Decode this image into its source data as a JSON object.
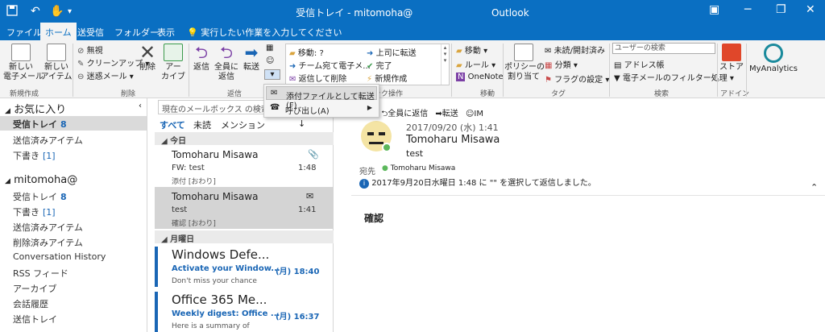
{
  "titlebar": {
    "title": "受信トレイ - mitomoha@",
    "app": "Outlook",
    "icons": {
      "save": "save-icon",
      "undo": "undo-icon",
      "touch": "touch-mode-icon",
      "customize": "customize-qat-icon",
      "ribbon_opts": "ribbon-display-options-icon",
      "minimize": "minimize-icon",
      "restore": "restore-icon",
      "close": "close-icon"
    },
    "symbols": {
      "undo": "↶",
      "touch": "✋",
      "more": "▾",
      "ribbon": "▣",
      "minimize": "─",
      "restore": "❐",
      "close": "✕"
    }
  },
  "tabs": [
    "ファイル",
    "ホーム",
    "送受信",
    "フォルダー",
    "表示"
  ],
  "tellme": "実行したい作業を入力してください",
  "ribbon": {
    "new_email": "新しい\n電子メール",
    "new_items": "新しい\nアイテム",
    "group_new": "新規作成",
    "ignore": "無視",
    "cleanup": "クリーンアップ",
    "junk": "迷惑メール",
    "delete": "削除",
    "archive": "アー\nカイブ",
    "group_delete": "削除",
    "reply": "返信",
    "reply_all": "全員に\n返信",
    "forward": "転送",
    "group_respond": "返信",
    "qs": [
      "移動: ?",
      "チーム宛て電子メ...",
      "返信して削除",
      "上司に転送",
      "完了",
      "新規作成"
    ],
    "group_qs": "クイック操作",
    "move": "移動",
    "rules": "ルール",
    "onenote": "OneNote",
    "group_move": "移動",
    "policy": "ポリシーの\n割り当て",
    "unread": "未読/開封済み",
    "categorize": "分類",
    "followup": "フラグの設定",
    "group_tags": "タグ",
    "search_people": "ユーザーの検索",
    "address_book": "アドレス帳",
    "filter_email": "電子メールのフィルター処理",
    "group_find": "検索",
    "store": "ストア",
    "group_addins": "アドイン",
    "myanalytics": "MyAnalytics"
  },
  "dropdown": {
    "items": [
      "添付ファイルとして転送(F)",
      "呼び出し(A)"
    ]
  },
  "folders": {
    "favorites": "お気に入り",
    "fav_items": [
      {
        "label": "受信トレイ",
        "count": "8"
      },
      {
        "label": "送信済みアイテム",
        "count": ""
      },
      {
        "label": "下書き",
        "count": "[1]"
      }
    ],
    "account": "mitomoha@",
    "acct_items": [
      {
        "label": "受信トレイ",
        "count": "8"
      },
      {
        "label": "下書き",
        "count": "[1]"
      },
      {
        "label": "送信済みアイテム",
        "count": ""
      },
      {
        "label": "削除済みアイテム",
        "count": ""
      },
      {
        "label": "Conversation History",
        "count": ""
      },
      {
        "label": "RSS フィード",
        "count": ""
      },
      {
        "label": "アーカイブ",
        "count": ""
      },
      {
        "label": "会話履歴",
        "count": ""
      },
      {
        "label": "送信トレイ",
        "count": ""
      }
    ]
  },
  "messagelist": {
    "search_placeholder": "現在のメールボックス の検索",
    "filters": [
      "すべて",
      "未読",
      "メンション"
    ],
    "sort": "↓",
    "groups": [
      "今日",
      "月曜日"
    ],
    "messages": [
      {
        "sender": "Tomoharu Misawa",
        "subject": "FW: test",
        "preview": "添付 [おわり]",
        "time": "1:48"
      },
      {
        "sender": "Tomoharu Misawa",
        "subject": "test",
        "preview": "確認 [おわり]",
        "time": "1:41"
      },
      {
        "sender": "Windows Defe...",
        "subject": "Activate your Window...",
        "date": "(月) 18:40",
        "preview": "Don't miss your chance"
      },
      {
        "sender": "Office 365 Me...",
        "subject": "Weekly digest: Office ...",
        "date": "(月) 16:37",
        "preview": "Here is a summary of"
      }
    ]
  },
  "reading": {
    "actions": [
      "返信",
      "全員に返信",
      "転送",
      "IM"
    ],
    "date": "2017/09/20 (水) 1:41",
    "sender": "Tomoharu Misawa",
    "subject": "test",
    "to_label": "宛先",
    "to": "Tomoharu Misawa",
    "info": "2017年9月20日水曜日 1:48 に \"\" を選択して返信しました。",
    "body": "確認"
  },
  "colors": {
    "accent": "#0a6fc2",
    "unread_blue": "#1a66b5"
  }
}
